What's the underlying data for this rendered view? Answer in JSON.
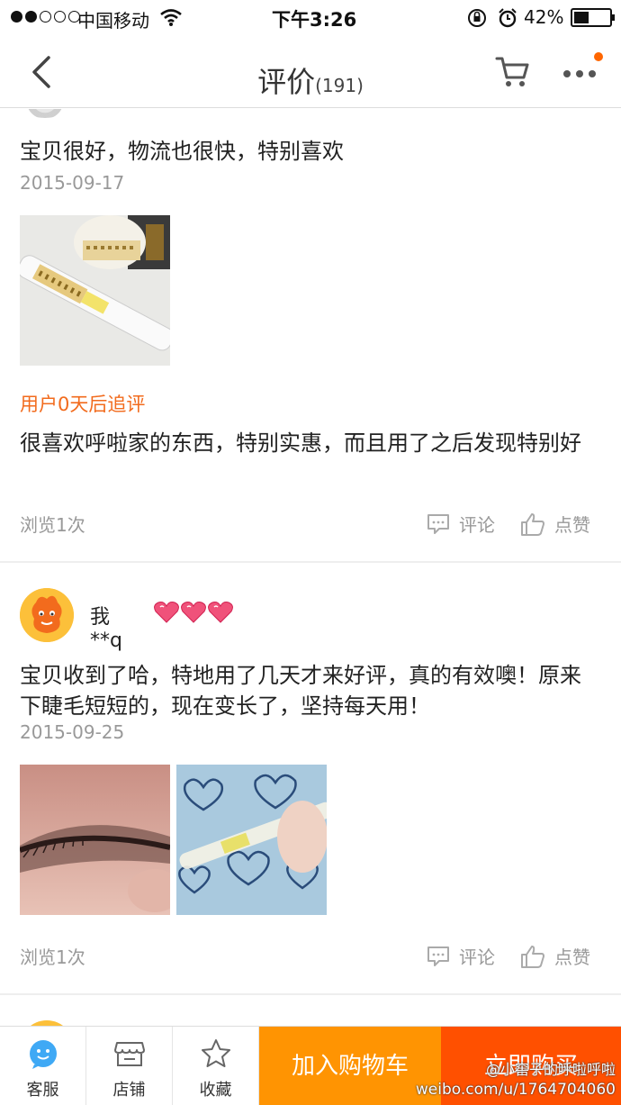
{
  "status_bar": {
    "carrier": "中国移动",
    "time": "下午3:26",
    "battery_percent": "42%",
    "battery_level": 0.42,
    "signal_bars_filled": 2,
    "signal_bars_total": 5
  },
  "nav": {
    "title": "评价",
    "count": "(191)",
    "icons": [
      "back-icon",
      "cart-icon",
      "more-icon"
    ],
    "badge_color": "#ff6600"
  },
  "reviews": [
    {
      "text": "宝贝很好，物流也很快，特别喜欢",
      "date": "2015-09-17",
      "photos": [
        "product-photo"
      ],
      "append": {
        "label": "用户0天后追评",
        "text": "很喜欢呼啦家的东西，特别实惠，而且用了之后发现特别好"
      },
      "views": "浏览1次",
      "comment_label": "评论",
      "like_label": "点赞"
    },
    {
      "username": "我**q",
      "text": "宝贝收到了哈，特地用了几天才来好评，真的有效噢！原来下睫毛短短的，现在变长了，坚持每天用！",
      "date": "2015-09-25",
      "photos": [
        "eyelash-photo",
        "product-in-hand-photo"
      ],
      "views": "浏览1次",
      "comment_label": "评论",
      "like_label": "点赞"
    }
  ],
  "bottom_bar": {
    "service_label": "客服",
    "store_label": "店铺",
    "favorite_label": "收藏",
    "add_to_cart_label": "加入购物车",
    "buy_now_label": "立即购买",
    "add_to_cart_color": "#ff9402",
    "buy_now_color": "#ff5000"
  },
  "watermark": {
    "handle": "@小窖子的呼啦呼啦",
    "url": "weibo.com/u/1764704060"
  },
  "colors": {
    "accent_orange": "#f26b1d",
    "muted_text": "#999999"
  }
}
